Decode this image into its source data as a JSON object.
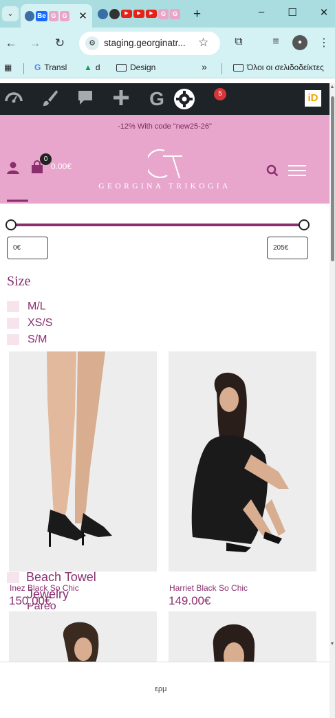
{
  "browser": {
    "tab_menu_icon": "chevron-down-icon",
    "tabs": [
      {
        "favicons": [
          "globe",
          "Be",
          "G",
          "G"
        ],
        "active": true
      },
      {
        "favicons": [
          "globe",
          "gpt",
          "yt",
          "yt",
          "yt",
          "G",
          "G"
        ],
        "active": false
      }
    ],
    "new_tab_symbol": "+",
    "window_controls": {
      "minimize": "–",
      "maximize": "☐",
      "close": "✕"
    },
    "url": "staging.georginatr...",
    "bookmarks": [
      {
        "label": "Transl",
        "icon": "google-icon"
      },
      {
        "label": "d",
        "icon": "drive-icon"
      },
      {
        "label": "Design",
        "icon": "folder-icon"
      }
    ],
    "bookmarks_overflow": "»",
    "all_bookmarks": "Όλοι οι σελιδοδείκτες"
  },
  "admin_bar": {
    "icons": [
      "dashboard-icon",
      "customize-brush-icon",
      "comments-icon",
      "new-plus-icon",
      "google-icon",
      "settings-gear-icon"
    ],
    "badge_count": "5",
    "id_logo": "iD"
  },
  "site": {
    "promo_text": "-12% With code \"new25-26\"",
    "logo_monogram": "GT",
    "logo_text": "GEORGINA TRIKOGIA",
    "cart_count": "0",
    "cart_total": "0.00€",
    "colors": {
      "brand_pink": "#e8a6cd",
      "brand_plum": "#8a2e6e",
      "admin_dark": "#1d2327"
    }
  },
  "filter": {
    "price_min": "0€",
    "price_max": "205€",
    "size_title": "Size",
    "sizes": [
      "M/L",
      "XS/S",
      "S/M"
    ],
    "overlapping_categories": [
      "Beach Towel",
      "Jewelry",
      "Pareo"
    ]
  },
  "products": [
    {
      "name": "Inez Black So Chic",
      "price": "150.00€"
    },
    {
      "name": "Harriet Black So Chic",
      "price": "149.00€"
    }
  ],
  "cookie": {
    "partial_text": "ερμ"
  }
}
